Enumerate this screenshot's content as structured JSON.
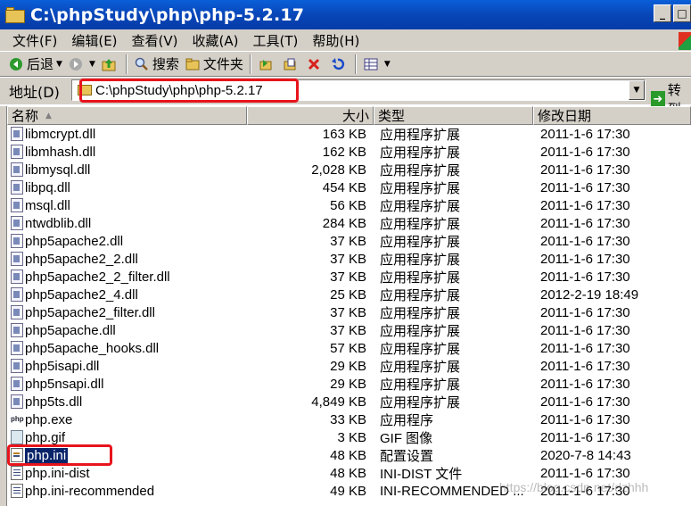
{
  "window": {
    "title": "C:\\phpStudy\\php\\php-5.2.17",
    "buttons": [
      "_",
      "□"
    ]
  },
  "menu": [
    "文件(F)",
    "编辑(E)",
    "查看(V)",
    "收藏(A)",
    "工具(T)",
    "帮助(H)"
  ],
  "toolbar": {
    "back": "后退",
    "search": "搜索",
    "folders": "文件夹"
  },
  "address": {
    "label": "地址(D)",
    "value": "C:\\phpStudy\\php\\php-5.2.17",
    "go": "转到"
  },
  "columns": {
    "name": "名称",
    "size": "大小",
    "type": "类型",
    "date": "修改日期"
  },
  "files": [
    {
      "name": "libmcrypt.dll",
      "size": "163 KB",
      "type": "应用程序扩展",
      "date": "2011-1-6 17:30",
      "icon": "dll"
    },
    {
      "name": "libmhash.dll",
      "size": "162 KB",
      "type": "应用程序扩展",
      "date": "2011-1-6 17:30",
      "icon": "dll"
    },
    {
      "name": "libmysql.dll",
      "size": "2,028 KB",
      "type": "应用程序扩展",
      "date": "2011-1-6 17:30",
      "icon": "dll"
    },
    {
      "name": "libpq.dll",
      "size": "454 KB",
      "type": "应用程序扩展",
      "date": "2011-1-6 17:30",
      "icon": "dll"
    },
    {
      "name": "msql.dll",
      "size": "56 KB",
      "type": "应用程序扩展",
      "date": "2011-1-6 17:30",
      "icon": "dll"
    },
    {
      "name": "ntwdblib.dll",
      "size": "284 KB",
      "type": "应用程序扩展",
      "date": "2011-1-6 17:30",
      "icon": "dll"
    },
    {
      "name": "php5apache2.dll",
      "size": "37 KB",
      "type": "应用程序扩展",
      "date": "2011-1-6 17:30",
      "icon": "dll"
    },
    {
      "name": "php5apache2_2.dll",
      "size": "37 KB",
      "type": "应用程序扩展",
      "date": "2011-1-6 17:30",
      "icon": "dll"
    },
    {
      "name": "php5apache2_2_filter.dll",
      "size": "37 KB",
      "type": "应用程序扩展",
      "date": "2011-1-6 17:30",
      "icon": "dll"
    },
    {
      "name": "php5apache2_4.dll",
      "size": "25 KB",
      "type": "应用程序扩展",
      "date": "2012-2-19 18:49",
      "icon": "dll"
    },
    {
      "name": "php5apache2_filter.dll",
      "size": "37 KB",
      "type": "应用程序扩展",
      "date": "2011-1-6 17:30",
      "icon": "dll"
    },
    {
      "name": "php5apache.dll",
      "size": "37 KB",
      "type": "应用程序扩展",
      "date": "2011-1-6 17:30",
      "icon": "dll"
    },
    {
      "name": "php5apache_hooks.dll",
      "size": "57 KB",
      "type": "应用程序扩展",
      "date": "2011-1-6 17:30",
      "icon": "dll"
    },
    {
      "name": "php5isapi.dll",
      "size": "29 KB",
      "type": "应用程序扩展",
      "date": "2011-1-6 17:30",
      "icon": "dll"
    },
    {
      "name": "php5nsapi.dll",
      "size": "29 KB",
      "type": "应用程序扩展",
      "date": "2011-1-6 17:30",
      "icon": "dll"
    },
    {
      "name": "php5ts.dll",
      "size": "4,849 KB",
      "type": "应用程序扩展",
      "date": "2011-1-6 17:30",
      "icon": "dll"
    },
    {
      "name": "php.exe",
      "size": "33 KB",
      "type": "应用程序",
      "date": "2011-1-6 17:30",
      "icon": "exe"
    },
    {
      "name": "php.gif",
      "size": "3 KB",
      "type": "GIF 图像",
      "date": "2011-1-6 17:30",
      "icon": "gif"
    },
    {
      "name": "php.ini",
      "size": "48 KB",
      "type": "配置设置",
      "date": "2020-7-8 14:43",
      "icon": "ini",
      "selected": true
    },
    {
      "name": "php.ini-dist",
      "size": "48 KB",
      "type": "INI-DIST 文件",
      "date": "2011-1-6 17:30",
      "icon": "txt"
    },
    {
      "name": "php.ini-recommended",
      "size": "49 KB",
      "type": "INI-RECOMMENDED ...",
      "date": "2011-1-6 17:30",
      "icon": "txt"
    }
  ],
  "watermark": "https://blog.csdn.net/dzhhh"
}
